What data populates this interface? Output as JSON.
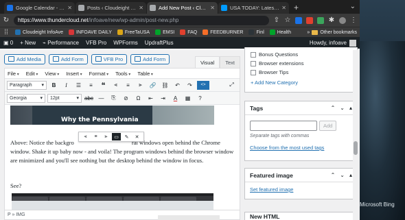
{
  "browser": {
    "tabs": [
      {
        "title": "Google Calendar - Week",
        "color": "#1a73e8"
      },
      {
        "title": "Posts ‹ Cloudeight InfoAv",
        "color": "#1d2327"
      },
      {
        "title": "Add New Post ‹ Cloudei",
        "color": "#1d2327",
        "active": true
      },
      {
        "title": "USA TODAY: Latest World",
        "color": "#009bff"
      }
    ],
    "new_tab": "+",
    "url_host": "https://www.thundercloud.net",
    "url_path": "/infoave/new/wp-admin/post-new.php",
    "bookmarks": [
      "Cloudeight InfoAve",
      "INFOAVE DAILY",
      "FreeTaUSA",
      "EMSI",
      "FAQ",
      "FEEDBURNER",
      "Finl",
      "Health"
    ],
    "bookmarks_more": "»",
    "other_bookmarks": "Other bookmarks"
  },
  "adminbar": {
    "comments": "0",
    "new": "+ New",
    "items": [
      "Performance",
      "VFB Pro",
      "WPForms",
      "UpdraftPlus"
    ],
    "howdy": "Howdy, infoave"
  },
  "editor": {
    "media_buttons": [
      "Add Media",
      "Add Form",
      "VFB Pro",
      "Add Form"
    ],
    "view_tabs": [
      "Visual",
      "Text"
    ],
    "menus": [
      "File",
      "Edit",
      "View",
      "Insert",
      "Format",
      "Tools",
      "Table"
    ],
    "format_select": "Paragraph",
    "font_select": "Georgia",
    "size_select": "12pt",
    "image_caption": "Why the Pennsylvania",
    "paragraph1": "Above: Notice the background... all windows open behind the Chrome window. Shake it up baby now - and voila! The program windows behind the browser window are minimized and you'll see nothing but the desktop behind the window in focus.",
    "paragraph1_visible_a": "Above: Notice the backgro",
    "paragraph1_visible_b": "ral windows open behind the",
    "paragraph1_rest": "Chrome window. Shake it up baby now - and voila! The program windows behind the browser window are minimized and you'll see nothing but the desktop behind the window in focus.",
    "paragraph2": "See?",
    "path": "P » IMG"
  },
  "sidebar": {
    "categories": [
      "Bonus Questions",
      "Browser extensions",
      "Browser Tips"
    ],
    "add_category": "+ Add New Category",
    "tags_title": "Tags",
    "tags_add": "Add",
    "tags_hint": "Separate tags with commas",
    "tags_link": "Choose from the most used tags",
    "featured_title": "Featured image",
    "featured_link": "Set featured image",
    "next_box": "New HTML"
  },
  "desktop": {
    "bing_label": "Microsoft Bing"
  }
}
